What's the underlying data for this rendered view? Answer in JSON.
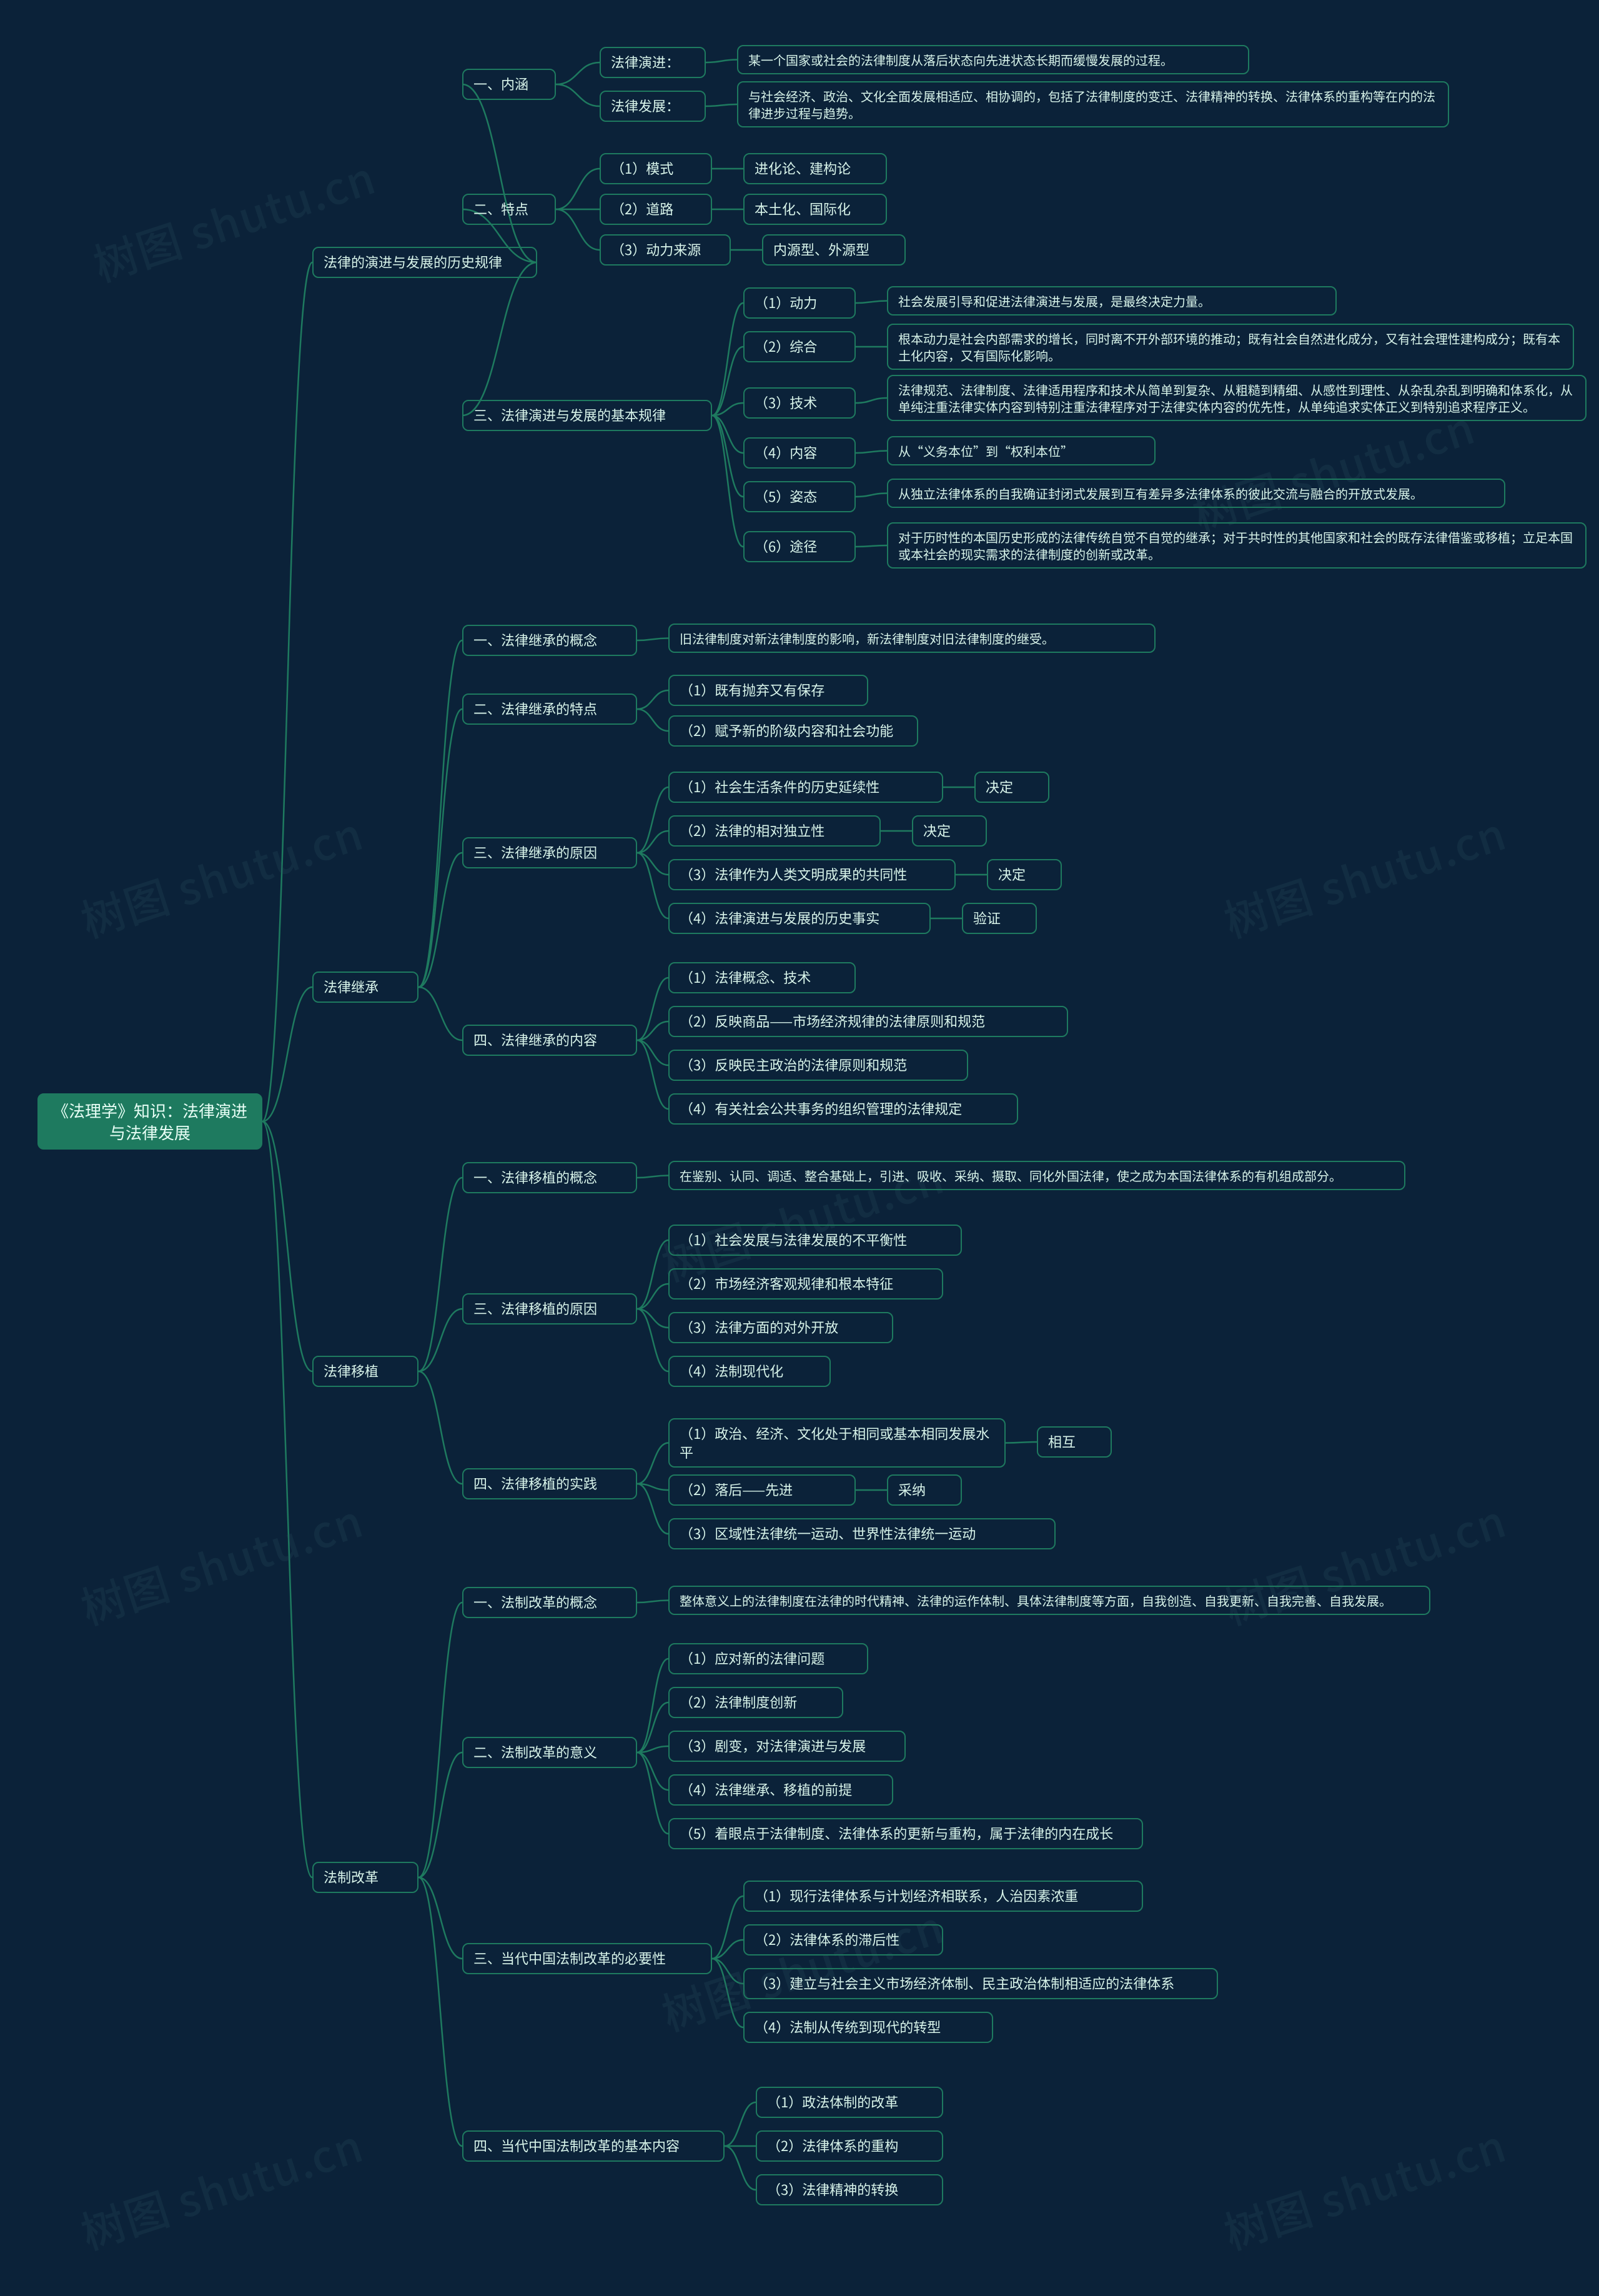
{
  "watermark_text": "树图 shutu.cn",
  "root": "《法理学》知识：法律演进与法律发展",
  "l1": {
    "a": "法律的演进与发展的历史规律",
    "b": "法律继承",
    "c": "法律移植",
    "d": "法制改革"
  },
  "a1": "一、内涵",
  "a1a": "法律演进：",
  "a1a_t": "某一个国家或社会的法律制度从落后状态向先进状态长期而缓慢发展的过程。",
  "a1b": "法律发展：",
  "a1b_t": "与社会经济、政治、文化全面发展相适应、相协调的，包括了法律制度的变迁、法律精神的转换、法律体系的重构等在内的法律进步过程与趋势。",
  "a2": "二、特点",
  "a2_1": "（1）模式",
  "a2_1t": "进化论、建构论",
  "a2_2": "（2）道路",
  "a2_2t": "本土化、国际化",
  "a2_3": "（3）动力来源",
  "a2_3t": "内源型、外源型",
  "a3": "三、法律演进与发展的基本规律",
  "a3_1": "（1）动力",
  "a3_1t": "社会发展引导和促进法律演进与发展，是最终决定力量。",
  "a3_2": "（2）综合",
  "a3_2t": "根本动力是社会内部需求的增长，同时离不开外部环境的推动；既有社会自然进化成分，又有社会理性建构成分；既有本土化内容，又有国际化影响。",
  "a3_3": "（3）技术",
  "a3_3t": "法律规范、法律制度、法律适用程序和技术从简单到复杂、从粗糙到精细、从感性到理性、从杂乱杂乱到明确和体系化，从单纯注重法律实体内容到特别注重法律程序对于法律实体内容的优先性，从单纯追求实体正义到特别追求程序正义。",
  "a3_4": "（4）内容",
  "a3_4t": "从“义务本位”到“权利本位”",
  "a3_5": "（5）姿态",
  "a3_5t": "从独立法律体系的自我确证封闭式发展到互有差异多法律体系的彼此交流与融合的开放式发展。",
  "a3_6": "（6）途径",
  "a3_6t": "对于历时性的本国历史形成的法律传统自觉不自觉的继承；对于共时性的其他国家和社会的既存法律借鉴或移植；立足本国或本社会的现实需求的法律制度的创新或改革。",
  "b1": "一、法律继承的概念",
  "b1t": "旧法律制度对新法律制度的影响，新法律制度对旧法律制度的继受。",
  "b2": "二、法律继承的特点",
  "b2_1": "（1）既有抛弃又有保存",
  "b2_2": "（2）赋予新的阶级内容和社会功能",
  "b3": "三、法律继承的原因",
  "b3_1": "（1）社会生活条件的历史延续性",
  "b3_1t": "决定",
  "b3_2": "（2）法律的相对独立性",
  "b3_2t": "决定",
  "b3_3": "（3）法律作为人类文明成果的共同性",
  "b3_3t": "决定",
  "b3_4": "（4）法律演进与发展的历史事实",
  "b3_4t": "验证",
  "b4": "四、法律继承的内容",
  "b4_1": "（1）法律概念、技术",
  "b4_2": "（2）反映商品——市场经济规律的法律原则和规范",
  "b4_3": "（3）反映民主政治的法律原则和规范",
  "b4_4": "（4）有关社会公共事务的组织管理的法律规定",
  "c1": "一、法律移植的概念",
  "c1t": "在鉴别、认同、调适、整合基础上，引进、吸收、采纳、摄取、同化外国法律，使之成为本国法律体系的有机组成部分。",
  "c3": "三、法律移植的原因",
  "c3_1": "（1）社会发展与法律发展的不平衡性",
  "c3_2": "（2）市场经济客观规律和根本特征",
  "c3_3": "（3）法律方面的对外开放",
  "c3_4": "（4）法制现代化",
  "c4": "四、法律移植的实践",
  "c4_1": "（1）政治、经济、文化处于相同或基本相同发展水平",
  "c4_1t": "相互",
  "c4_2": "（2）落后——先进",
  "c4_2t": "采纳",
  "c4_3": "（3）区域性法律统一运动、世界性法律统一运动",
  "d1": "一、法制改革的概念",
  "d1t": "整体意义上的法律制度在法律的时代精神、法律的运作体制、具体法律制度等方面，自我创造、自我更新、自我完善、自我发展。",
  "d2": "二、法制改革的意义",
  "d2_1": "（1）应对新的法律问题",
  "d2_2": "（2）法律制度创新",
  "d2_3": "（3）剧变，对法律演进与发展",
  "d2_4": "（4）法律继承、移植的前提",
  "d2_5": "（5）着眼点于法律制度、法律体系的更新与重构，属于法律的内在成长",
  "d3": "三、当代中国法制改革的必要性",
  "d3_1": "（1）现行法律体系与计划经济相联系，人治因素浓重",
  "d3_2": "（2）法律体系的滞后性",
  "d3_3": "（3）建立与社会主义市场经济体制、民主政治体制相适应的法律体系",
  "d3_4": "（4）法制从传统到现代的转型",
  "d4": "四、当代中国法制改革的基本内容",
  "d4_1": "（1）政法体制的改革",
  "d4_2": "（2）法律体系的重构",
  "d4_3": "（3）法律精神的转换"
}
